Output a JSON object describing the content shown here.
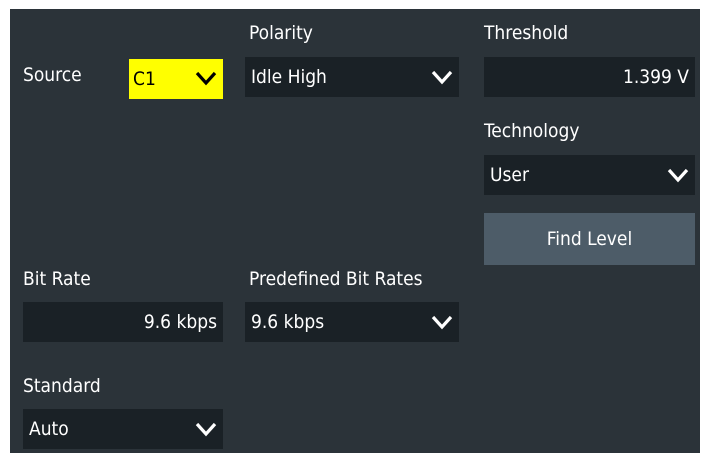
{
  "source": {
    "label": "Source",
    "value": "C1"
  },
  "polarity": {
    "label": "Polarity",
    "value": "Idle High"
  },
  "threshold": {
    "label": "Threshold",
    "value": "1.399 V"
  },
  "technology": {
    "label": "Technology",
    "value": "User"
  },
  "find_level": {
    "label": "Find Level"
  },
  "bit_rate": {
    "label": "Bit Rate",
    "value": "9.6 kbps"
  },
  "predefined_bit_rates": {
    "label": "Predefined Bit Rates",
    "value": "9.6 kbps"
  },
  "standard": {
    "label": "Standard",
    "value": "Auto"
  },
  "colors": {
    "panel_bg": "#2b3339",
    "field_bg": "#1a2126",
    "source_highlight": "#ffff00",
    "button_bg": "#4d5c68",
    "text": "#ffffff"
  },
  "icons": {
    "dropdown": "chevron-down-icon"
  }
}
